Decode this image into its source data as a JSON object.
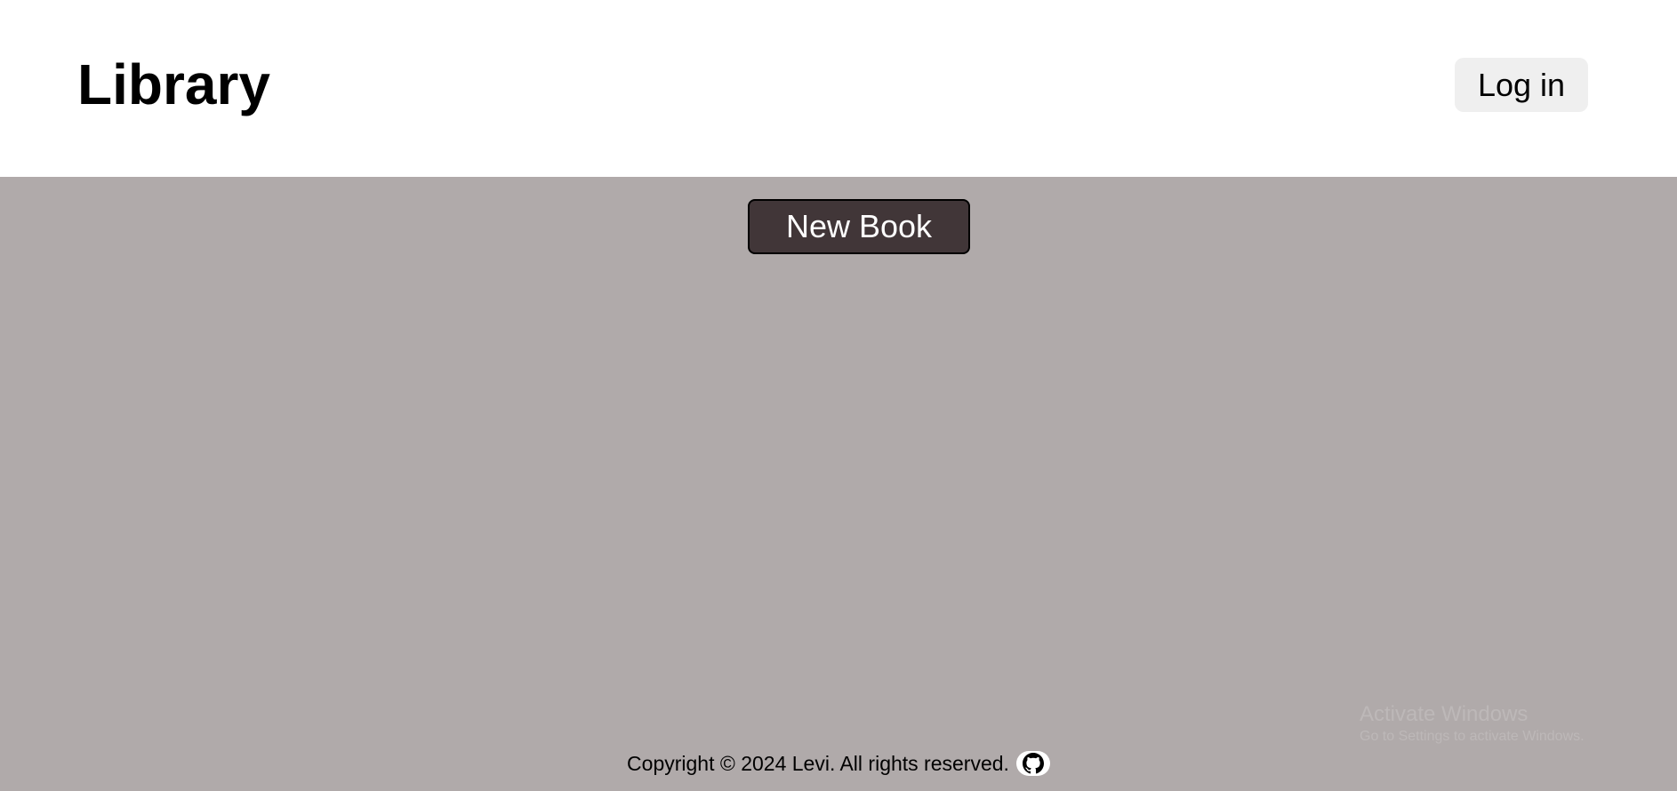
{
  "header": {
    "title": "Library",
    "login_label": "Log in"
  },
  "main": {
    "new_book_label": "New Book"
  },
  "footer": {
    "copyright": "Copyright © 2024 Levi. All rights reserved.",
    "github_icon": "github-icon"
  },
  "watermark": {
    "title": "Activate Windows",
    "subtitle": "Go to Settings to activate Windows."
  },
  "colors": {
    "header_bg": "#ffffff",
    "page_bg": "#b0aaaa",
    "button_dark": "#413638",
    "login_bg": "#efefef"
  }
}
